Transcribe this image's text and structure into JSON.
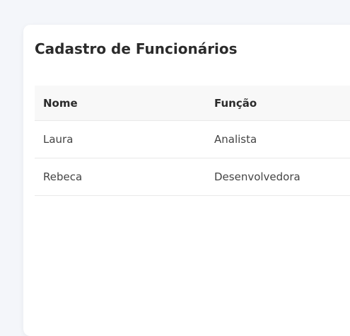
{
  "page": {
    "title": "Cadastro de Funcionários"
  },
  "table": {
    "columns": [
      "Nome",
      "Função"
    ],
    "rows": [
      {
        "nome": "Laura",
        "funcao": "Analista"
      },
      {
        "nome": "Rebeca",
        "funcao": "Desenvolvedora"
      }
    ]
  }
}
